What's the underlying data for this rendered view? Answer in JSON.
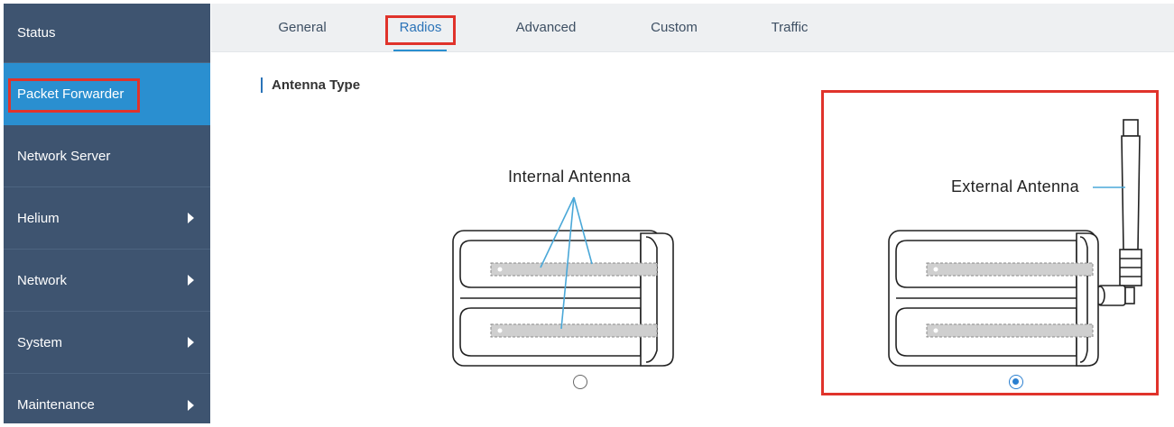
{
  "sidebar": {
    "items": [
      {
        "label": "Status",
        "has_submenu": false,
        "active": false
      },
      {
        "label": "Packet Forwarder",
        "has_submenu": false,
        "active": true
      },
      {
        "label": "Network Server",
        "has_submenu": false,
        "active": false
      },
      {
        "label": "Helium",
        "has_submenu": true,
        "active": false
      },
      {
        "label": "Network",
        "has_submenu": true,
        "active": false
      },
      {
        "label": "System",
        "has_submenu": true,
        "active": false
      },
      {
        "label": "Maintenance",
        "has_submenu": true,
        "active": false
      }
    ]
  },
  "tabs": [
    {
      "label": "General"
    },
    {
      "label": "Radios",
      "active": true
    },
    {
      "label": "Advanced"
    },
    {
      "label": "Custom"
    },
    {
      "label": "Traffic"
    }
  ],
  "main": {
    "section_title": "Antenna Type",
    "internal": {
      "label": "Internal Antenna",
      "selected": false
    },
    "external": {
      "label": "External Antenna",
      "selected": true
    }
  },
  "colors": {
    "sidebar_bg": "#3e5470",
    "sidebar_active": "#2a8fd0",
    "highlight_red": "#e0332b",
    "accent_blue": "#2a7fd0",
    "callout_line": "#4aa8d8"
  }
}
